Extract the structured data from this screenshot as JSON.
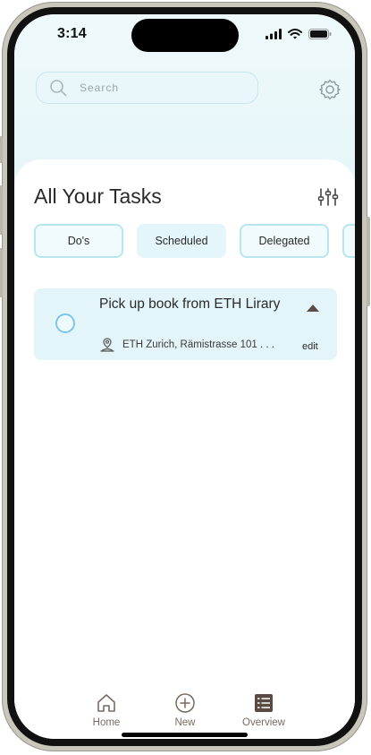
{
  "status_bar": {
    "time": "3:14"
  },
  "search": {
    "placeholder": "Search"
  },
  "header": {
    "title": "All Your Tasks"
  },
  "tabs": [
    {
      "label": "Do's"
    },
    {
      "label": "Scheduled"
    },
    {
      "label": "Delegated"
    }
  ],
  "task": {
    "title": "Pick up book from ETH Lirary",
    "location": "ETH Zurich, Rämistrasse 101 . . .",
    "edit_label": "edit"
  },
  "bottom_nav": [
    {
      "label": "Home",
      "icon": "home-icon"
    },
    {
      "label": "New",
      "icon": "plus-circle-icon"
    },
    {
      "label": "Overview",
      "icon": "list-icon"
    }
  ],
  "colors": {
    "accent": "#b7e6ef",
    "header_background": "#e3f5f8",
    "card_background": "#e3f5f9",
    "checkbox": "#7bc7ea",
    "nav_icon": "#7a6a60"
  }
}
